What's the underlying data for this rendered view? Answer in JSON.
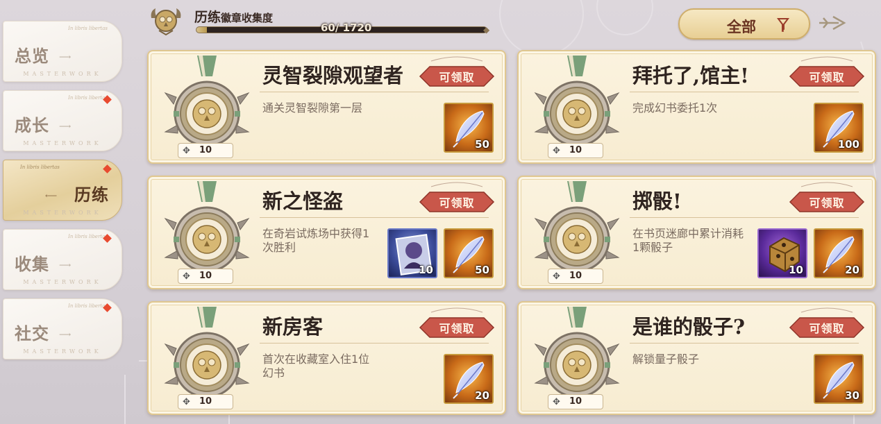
{
  "sidebar": {
    "items": [
      {
        "label": "总览",
        "tiny": "In libris libertas",
        "footer": "MASTERWORK",
        "badge": false,
        "active": false
      },
      {
        "label": "成长",
        "tiny": "In libris libertas",
        "footer": "MASTERWORK",
        "badge": true,
        "active": false
      },
      {
        "label": "历练",
        "tiny": "In libris libertas",
        "footer": "MASTERWORK",
        "badge": true,
        "active": true
      },
      {
        "label": "收集",
        "tiny": "In libris libertas",
        "footer": "MASTERWORK",
        "badge": true,
        "active": false
      },
      {
        "label": "社交",
        "tiny": "In libris libertas",
        "footer": "MASTERWORK",
        "badge": true,
        "active": false
      }
    ]
  },
  "header": {
    "title": "历练",
    "subtitle": "徽章收集度",
    "progress_text": "60/ 1720",
    "progress_value": 60,
    "progress_max": 1720
  },
  "filter": {
    "label": "全部"
  },
  "cards": [
    {
      "title": "灵智裂隙观望者",
      "desc": "通关灵智裂隙第一层",
      "claim": "可领取",
      "medal_count": "10",
      "rewards": [
        {
          "type": "feather",
          "color": "orange",
          "qty": "50"
        }
      ]
    },
    {
      "title": "拜托了,馆主!",
      "desc": "完成幻书委托1次",
      "claim": "可领取",
      "medal_count": "10",
      "rewards": [
        {
          "type": "feather",
          "color": "orange",
          "qty": "100"
        }
      ]
    },
    {
      "title": "新之怪盗",
      "desc": "在奇岩试炼场中获得1次胜利",
      "claim": "可领取",
      "medal_count": "10",
      "rewards": [
        {
          "type": "portrait",
          "color": "blue",
          "qty": "10"
        },
        {
          "type": "feather",
          "color": "orange",
          "qty": "50"
        }
      ]
    },
    {
      "title": "掷骰!",
      "desc": "在书页迷廊中累计消耗1颗骰子",
      "claim": "可领取",
      "medal_count": "10",
      "rewards": [
        {
          "type": "dice",
          "color": "purple",
          "qty": "10"
        },
        {
          "type": "feather",
          "color": "orange",
          "qty": "20"
        }
      ]
    },
    {
      "title": "新房客",
      "desc": "首次在收藏室入住1位幻书",
      "claim": "可领取",
      "medal_count": "10",
      "rewards": [
        {
          "type": "feather",
          "color": "orange",
          "qty": "20"
        }
      ]
    },
    {
      "title": "是谁的骰子?",
      "desc": "解锁量子骰子",
      "claim": "可领取",
      "medal_count": "10",
      "rewards": [
        {
          "type": "feather",
          "color": "orange",
          "qty": "30"
        }
      ]
    }
  ],
  "colors": {
    "badge": "#e84a2f",
    "claim_tag": "#c9574a",
    "card_bg": "#f7ecd1",
    "card_border": "#e0c78f",
    "medal_ribbon": "#7aa07a"
  },
  "icons": {
    "header": "owl-emblem-icon",
    "filter": "funnel-icon",
    "nav": "arrow-right-icon",
    "medal": "owl-medal-icon",
    "feather": "feather-icon",
    "dice": "dice-icon",
    "portrait": "character-portrait-icon"
  }
}
